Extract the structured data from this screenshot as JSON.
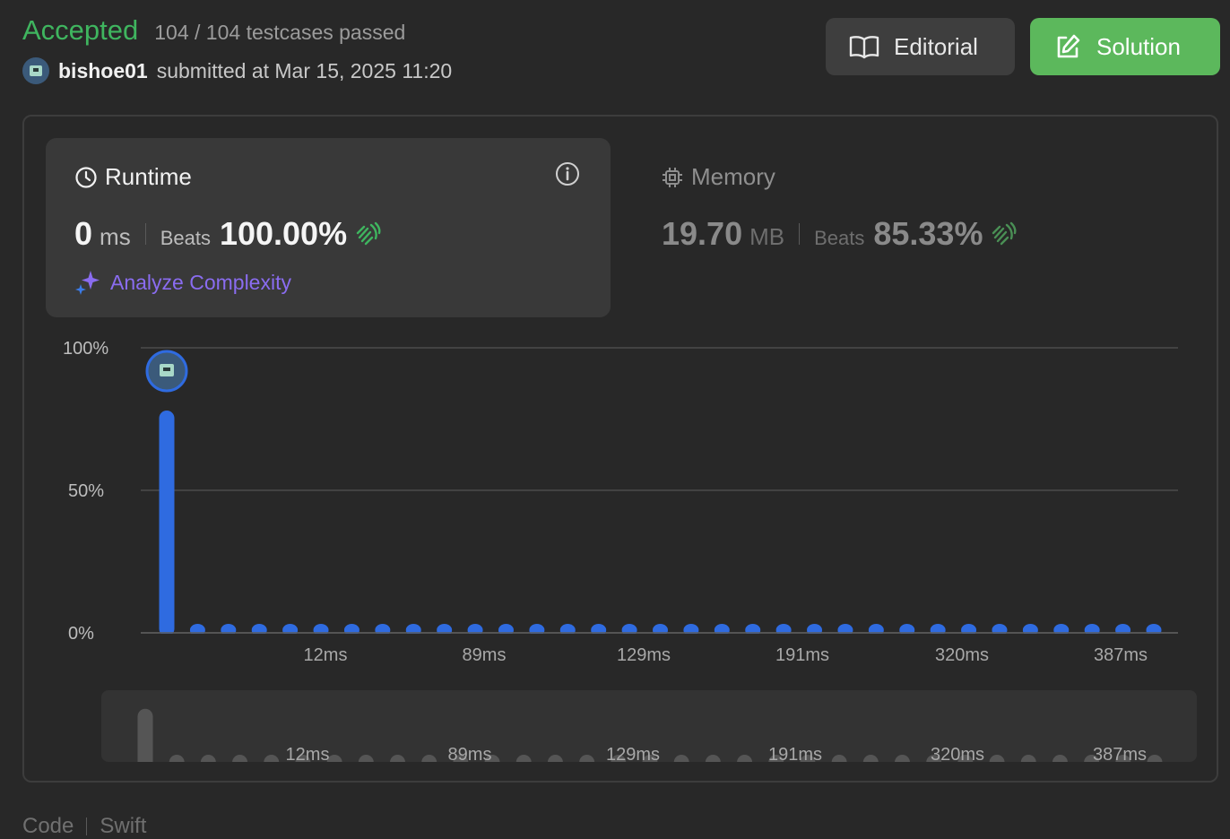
{
  "header": {
    "status": "Accepted",
    "testcases": "104 / 104 testcases passed",
    "username": "bishoe01",
    "submitted": "submitted at Mar 15, 2025 11:20"
  },
  "buttons": {
    "editorial": "Editorial",
    "solution": "Solution"
  },
  "runtime": {
    "title": "Runtime",
    "value": "0",
    "unit": "ms",
    "beats_label": "Beats",
    "beats": "100.00%",
    "analyze": "Analyze Complexity"
  },
  "memory": {
    "title": "Memory",
    "value": "19.70",
    "unit": "MB",
    "beats_label": "Beats",
    "beats": "85.33%"
  },
  "colors": {
    "accepted": "#3fb55f",
    "solution_button": "#5cb85c",
    "bar": "#2f6be0",
    "analyze": "#8a6cf0",
    "clap": "#3fb55f"
  },
  "icons": {
    "editorial": "book-open-icon",
    "solution": "edit-icon",
    "runtime": "clock-icon",
    "memory": "chip-icon",
    "info": "info-icon",
    "analyze": "sparkle-icon",
    "beats": "clapping-hands-icon"
  },
  "chart_data": {
    "type": "bar",
    "y_ticks": [
      "100%",
      "50%",
      "0%"
    ],
    "ylim": [
      0,
      100
    ],
    "x_tick_labels": [
      "12ms",
      "89ms",
      "129ms",
      "191ms",
      "320ms",
      "387ms"
    ],
    "values": [
      78,
      0.7,
      0.7,
      0.7,
      0.7,
      0.7,
      0.7,
      0.7,
      0.7,
      0.7,
      0.7,
      0.7,
      0.7,
      0.7,
      0.7,
      0.7,
      0.7,
      0.7,
      0.7,
      0.7,
      0.7,
      0.7,
      0.7,
      0.7,
      0.7,
      0.7,
      0.7,
      0.7,
      0.7,
      0.7,
      0.7,
      0.7,
      0.7
    ],
    "highlight_index": 0,
    "grid": true
  },
  "footer_peek": {
    "tab1": "Code",
    "tab2": "Swift"
  }
}
